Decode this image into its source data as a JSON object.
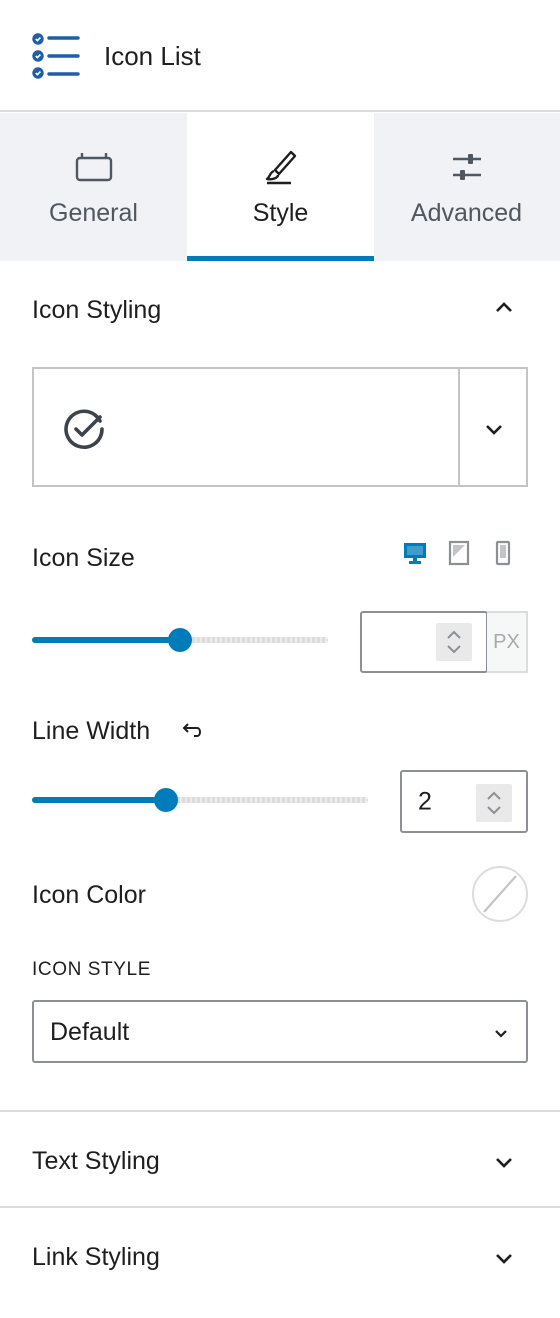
{
  "header": {
    "title": "Icon List",
    "icon": "list-checks-icon"
  },
  "tabs": [
    {
      "label": "General",
      "icon": "card-icon",
      "active": false
    },
    {
      "label": "Style",
      "icon": "brush-icon",
      "active": true
    },
    {
      "label": "Advanced",
      "icon": "sliders-icon",
      "active": false
    }
  ],
  "icon_styling": {
    "title": "Icon Styling",
    "selected_icon": "check-circle-icon",
    "icon_size": {
      "label": "Icon Size",
      "devices": [
        "desktop-icon",
        "tablet-icon",
        "mobile-icon"
      ],
      "active_device": "desktop",
      "value": "",
      "unit": "PX",
      "slider_fraction": 0.5
    },
    "line_width": {
      "label": "Line Width",
      "reset_icon": "undo-icon",
      "value": "2",
      "slider_fraction": 0.4
    },
    "icon_color": {
      "label": "Icon Color",
      "value": "none"
    },
    "icon_style": {
      "label": "ICON STYLE",
      "selected": "Default"
    }
  },
  "text_styling": {
    "title": "Text Styling"
  },
  "link_styling": {
    "title": "Link Styling"
  },
  "colors": {
    "accent": "#007cba",
    "border": "#c3c4c7",
    "text": "#1e1e1e",
    "tab_bg": "#f0f2f6"
  }
}
